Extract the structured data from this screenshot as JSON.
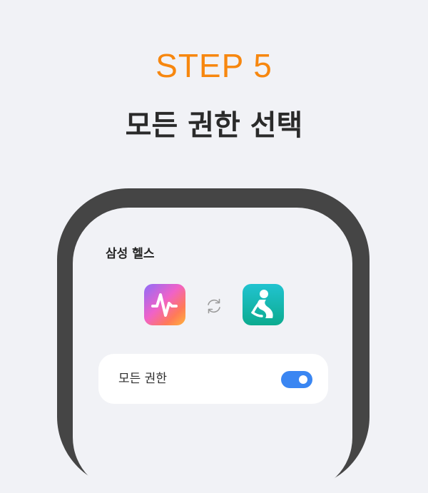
{
  "header": {
    "step": "STEP 5",
    "title": "모든 권한 선택"
  },
  "app": {
    "title": "삼성 헬스"
  },
  "icons": {
    "health": "samsung-health-icon",
    "sync": "sync-icon",
    "together": "samsung-together-icon"
  },
  "permission": {
    "label": "모든 권한",
    "enabled": true
  },
  "colors": {
    "accent": "#f7870f",
    "toggle_on": "#3a86f2",
    "frame": "#454545",
    "background": "#f1f2f6"
  }
}
